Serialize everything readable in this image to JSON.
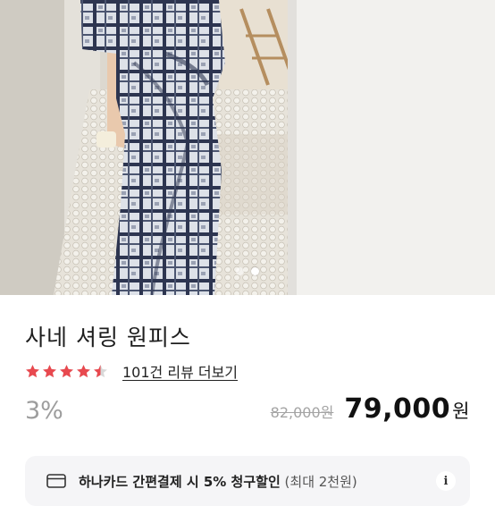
{
  "product": {
    "title": "사네 셔링 원피스",
    "rating": 4.5,
    "review_link": "101건 리뷰 더보기",
    "discount_rate": "3%",
    "original_price": "82,000원",
    "sale_price": "79,000",
    "sale_price_unit": "원"
  },
  "gallery": {
    "image_count": 2,
    "active_index": 1
  },
  "card_promo": {
    "text_main": "하나카드 간편결제 시 5% 청구할인",
    "text_sub": "(최대 2천원)",
    "card_icon": "credit-card-icon",
    "info_icon": "info-icon",
    "info_glyph": "i"
  },
  "colors": {
    "star": "#e8494f",
    "star_empty": "#d9d9d9",
    "banner_bg": "#f5f5f7"
  }
}
